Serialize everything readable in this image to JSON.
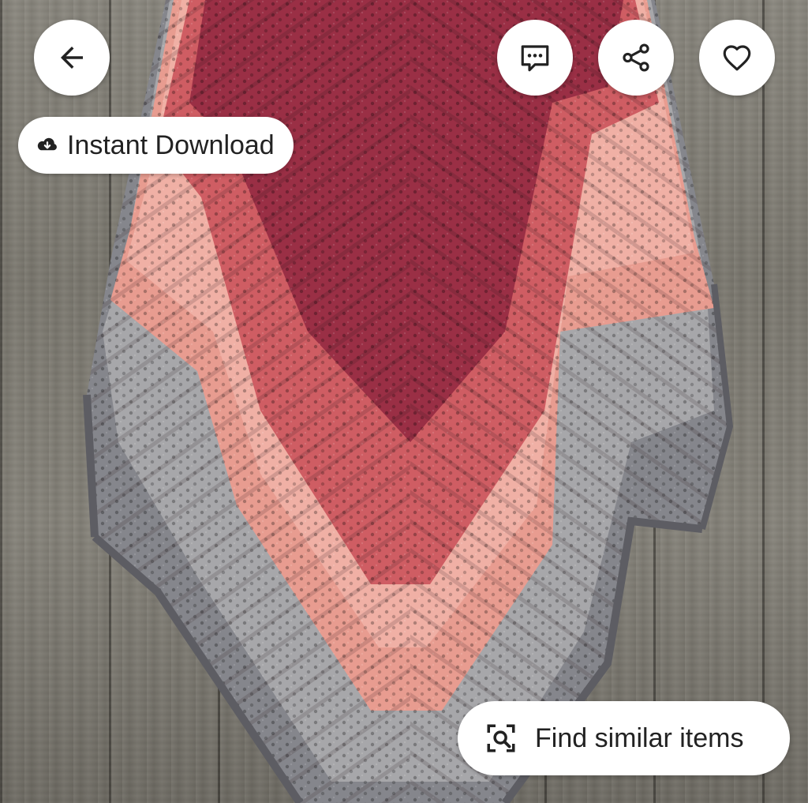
{
  "listing_image": {
    "alt": "Crochet triangle shawl in burgundy, coral pink and grey gradient hanging on a wooden wall"
  },
  "top_bar": {
    "back_icon": "arrow-left-icon",
    "message_icon": "chat-bubble-icon",
    "share_icon": "share-icon",
    "favorite_icon": "heart-outline-icon"
  },
  "badge": {
    "label": "Instant Download",
    "icon": "cloud-download-icon"
  },
  "find_similar": {
    "label": "Find similar items",
    "icon": "visual-search-icon"
  },
  "colors": {
    "button_bg": "#ffffff",
    "icon_color": "#222222",
    "shawl_burgundy": "#9a2f45",
    "shawl_coral": "#e99a8f",
    "shawl_grey": "#8e8f94",
    "wood": "#7d7a72"
  }
}
